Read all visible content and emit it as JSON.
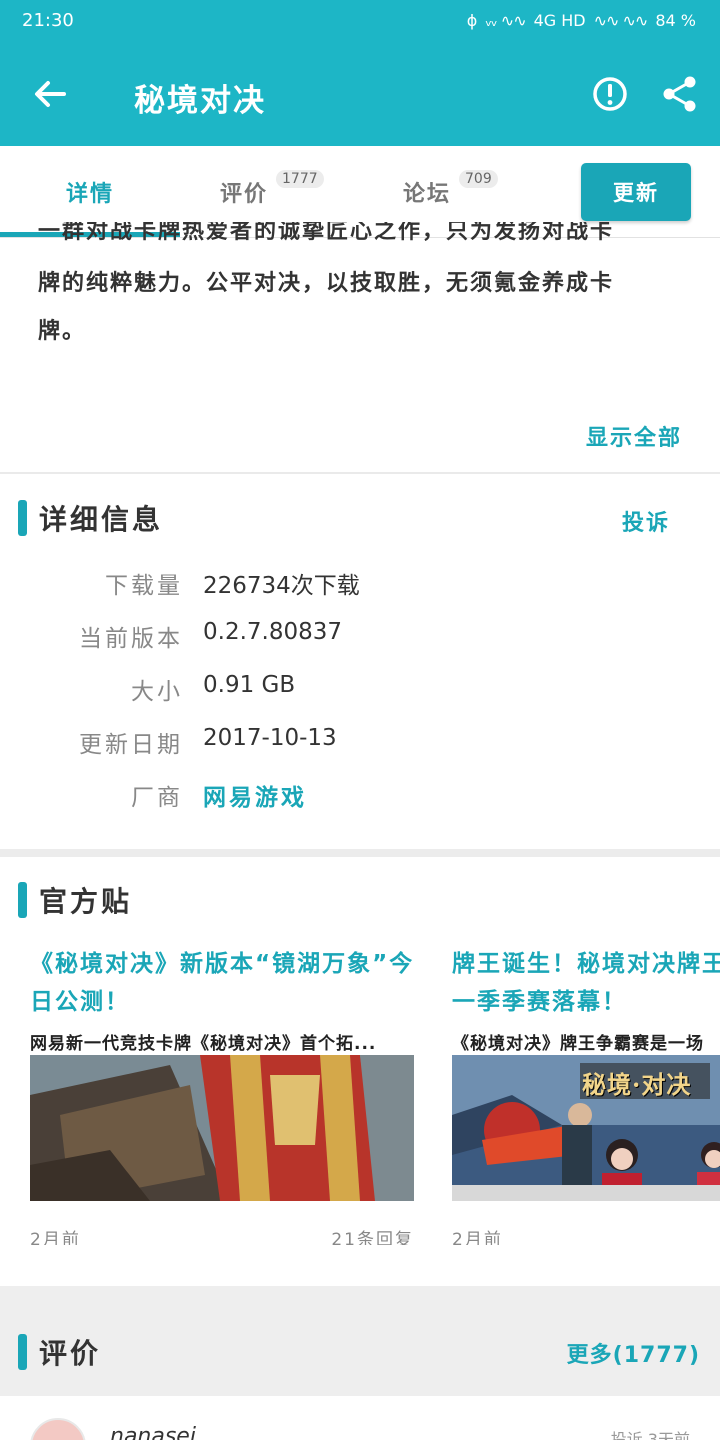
{
  "status": {
    "time": "21:30",
    "network": "4G HD",
    "battery": "84 %"
  },
  "appbar": {
    "title": "秘境对决"
  },
  "tabs": [
    {
      "label": "详情",
      "badge": ""
    },
    {
      "label": "评价",
      "badge": "1777"
    },
    {
      "label": "论坛",
      "badge": "709"
    }
  ],
  "update_label": "更新",
  "description": {
    "line1": "一群对战卡牌热爱者的诚挚匠心之作，只为发扬对战卡",
    "line2": "牌的纯粹魅力。公平对决，以技取胜，无须氪金养成卡",
    "line3": "牌。",
    "show_all": "显示全部"
  },
  "details": {
    "title": "详细信息",
    "report": "投诉",
    "rows": [
      {
        "key": "下载量",
        "value": "226734次下载"
      },
      {
        "key": "当前版本",
        "value": "0.2.7.80837"
      },
      {
        "key": "大小",
        "value": "0.91 GB"
      },
      {
        "key": "更新日期",
        "value": "2017-10-13"
      },
      {
        "key": "厂商",
        "value": "网易游戏"
      }
    ]
  },
  "official": {
    "title": "官方贴",
    "posts": [
      {
        "title": "《秘境对决》新版本“镜湖万象”今日公测！",
        "summary": "网易新一代竞技卡牌《秘境对决》首个拓...",
        "time": "2月前",
        "replies": "21条回复"
      },
      {
        "title": "牌王诞生！秘境对决牌王争霸赛第一季季赛落幕！",
        "summary": "《秘境对决》牌王争霸赛是一场",
        "time": "2月前",
        "replies": "",
        "image_text": "秘境·对决"
      }
    ]
  },
  "reviews": {
    "title": "评价",
    "more": "更多(1777)",
    "first_user": "nanasei",
    "first_meta": "投诉 3天前"
  },
  "colors": {
    "accent": "#1aa6b7",
    "appbar": "#1db6c6"
  }
}
